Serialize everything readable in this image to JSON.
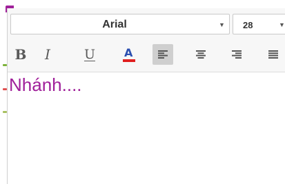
{
  "editor": {
    "font_family": "Arial",
    "font_size": "28",
    "content": "Nhánh...."
  },
  "toolbar": {
    "bold_label": "B",
    "italic_label": "I",
    "underline_label": "U",
    "color_label": "A",
    "buttons": [
      "bold-icon",
      "italic-icon",
      "underline-icon",
      "text-color-icon",
      "align-left-icon",
      "align-center-icon",
      "align-right-icon",
      "align-justify-icon"
    ],
    "active_alignment": "left"
  },
  "colors": {
    "text": "#a0209a",
    "text_color_swatch": "#e02020",
    "color_letter": "#2b4fb0",
    "accent": "#a0209a",
    "active_button_bg": "#cfcfcf",
    "edge_marks": [
      "#7db33b",
      "#e05050",
      "#a8c060"
    ]
  }
}
